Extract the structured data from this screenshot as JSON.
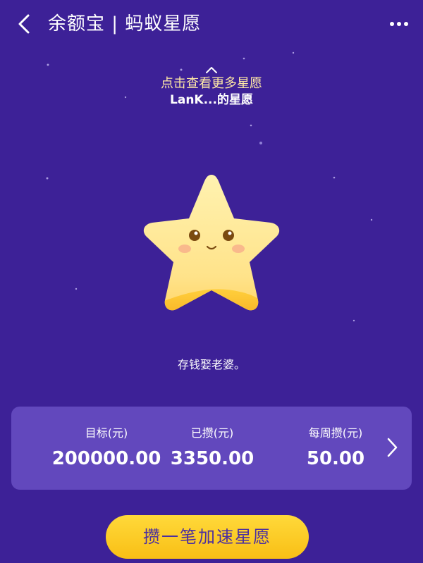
{
  "header": {
    "title": "余额宝 | 蚂蚁星愿",
    "back_icon": "chevron-left-icon",
    "more_icon": "more-dots-icon"
  },
  "wish": {
    "more_hint": "点击查看更多星愿",
    "owner": "LanK...的星愿",
    "description": "存钱娶老婆。"
  },
  "stats": [
    {
      "label": "目标(元)",
      "value": "200000.00"
    },
    {
      "label": "已攒(元)",
      "value": "3350.00"
    },
    {
      "label": "每周攒(元)",
      "value": "50.00"
    }
  ],
  "action": {
    "save_label": "攒一笔加速星愿"
  },
  "colors": {
    "background": "#3d2197",
    "card": "#6248bd",
    "accent_yellow": "#ffd93a",
    "hint_text": "#ffe9a6"
  }
}
